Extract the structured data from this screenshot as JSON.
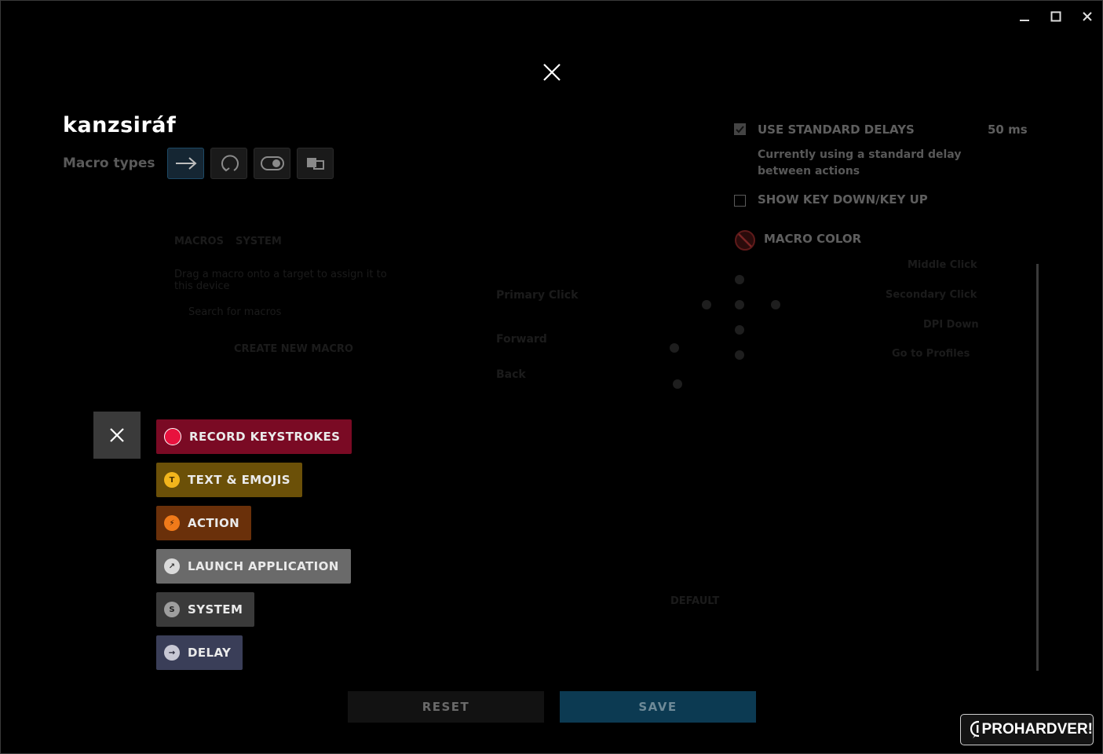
{
  "window": {
    "minimize_icon": "minimize-icon",
    "maximize_icon": "maximize-icon",
    "close_icon": "close-icon"
  },
  "dialog": {
    "close_icon": "close-icon"
  },
  "macro": {
    "name": "kanzsiráf",
    "types_label": "Macro types",
    "types": [
      {
        "icon": "arrow-right-icon",
        "active": true
      },
      {
        "icon": "repeat-icon",
        "active": false
      },
      {
        "icon": "toggle-icon",
        "active": false
      },
      {
        "icon": "sequence-icon",
        "active": false
      }
    ]
  },
  "options": {
    "standard_delays": {
      "label": "USE STANDARD DELAYS",
      "value": "50 ms",
      "checked": true,
      "description": "Currently using a standard delay between actions"
    },
    "show_key": {
      "label": "SHOW KEY DOWN/KEY UP",
      "checked": false
    },
    "macro_color": {
      "label": "MACRO COLOR",
      "icon": "no-color-icon"
    }
  },
  "add_menu": {
    "close_icon": "close-icon",
    "items": [
      {
        "label": "RECORD KEYSTROKES",
        "icon": "record-icon",
        "glyph": "",
        "bg": "#7a0a24",
        "icon_bg": "#e8123e",
        "icon_fg": "#ffffff"
      },
      {
        "label": "TEXT & EMOJIS",
        "icon": "text-icon",
        "glyph": "T",
        "bg": "#6b5008",
        "icon_bg": "#f2b51c",
        "icon_fg": "#4a3200"
      },
      {
        "label": "ACTION",
        "icon": "lightning-icon",
        "glyph": "⚡",
        "bg": "#6a300a",
        "icon_bg": "#f07a1a",
        "icon_fg": "#2a1200"
      },
      {
        "label": "LAUNCH APPLICATION",
        "icon": "external-link-icon",
        "glyph": "↗",
        "bg": "#6a6a6a",
        "icon_bg": "#dadada",
        "icon_fg": "#333333"
      },
      {
        "label": "SYSTEM",
        "icon": "system-icon",
        "glyph": "S",
        "bg": "#3a3a3a",
        "icon_bg": "#9e9e9e",
        "icon_fg": "#222222"
      },
      {
        "label": "DELAY",
        "icon": "delay-icon",
        "glyph": "→",
        "bg": "#3a3e58",
        "icon_bg": "#c8c8d4",
        "icon_fg": "#222233"
      }
    ]
  },
  "footer": {
    "reset": "RESET",
    "save": "SAVE"
  },
  "watermark": {
    "text": "PROHARDVER!"
  },
  "background_ghost": {
    "left": [
      "MACROS",
      "SYSTEM",
      "Drag a macro onto a target to assign it to this device",
      "Search for macros",
      "CREATE NEW MACRO"
    ],
    "center": [
      "Primary Click",
      "Forward",
      "Back"
    ],
    "right": [
      "Middle Click",
      "Secondary Click",
      "DPI Down",
      "Go to Profiles"
    ],
    "bottom": [
      "DEFAULT"
    ]
  }
}
